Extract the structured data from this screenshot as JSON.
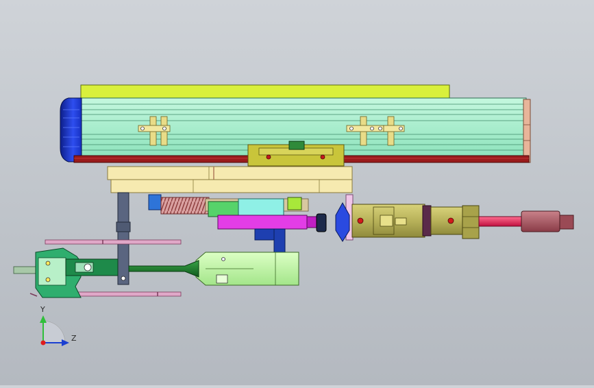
{
  "viewport": {
    "background_top": "#cfd3d8",
    "background_bottom": "#b4b9c0"
  },
  "triad": {
    "y_label": "Y",
    "z_label": "Z",
    "y_axis_color": "#2fbf3a",
    "z_axis_color": "#1a3fd1",
    "x_axis_color": "#e01c1c"
  },
  "parts": {
    "top_plate_color": "#d9f03c",
    "linear_rail_body_color": "#aef2cf",
    "end_cap_left_color": "#1d36c8",
    "end_cap_right_color": "#e8b59a",
    "bottom_rail_color": "#9a1b1b",
    "carriage_color": "#c9c53a",
    "mount_block_color": "#f6eab0",
    "cylinder_body_color": "#b8b25a",
    "piston_rod_color": "#e0245a",
    "magenta_block_color": "#e33de6",
    "cyan_block_color": "#8ff0e6",
    "gun_body_color": "#c4f5a8",
    "gun_nozzle_color": "#1d7a2a",
    "gripper_head_color": "#2fae6e",
    "navy_bracket_color": "#1e3fb0",
    "slate_bracket_color": "#4f5a73",
    "spring_color": "#c46b6b"
  }
}
